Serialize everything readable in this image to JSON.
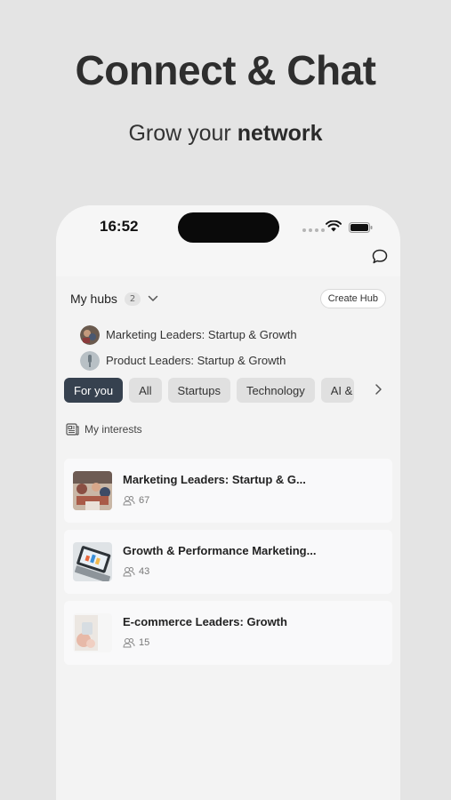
{
  "promo": {
    "headline": "Connect & Chat",
    "subhead_prefix": "Grow your ",
    "subhead_bold": "network"
  },
  "status_bar": {
    "time": "16:52"
  },
  "hubs": {
    "title": "My hubs",
    "count": "2",
    "create_label": "Create Hub",
    "items": [
      {
        "name": "Marketing Leaders: Startup & Growth",
        "avatar_color": "#6a5a4e"
      },
      {
        "name": "Product Leaders: Startup & Growth",
        "avatar_color": "#9aa6ad"
      }
    ]
  },
  "tabs": [
    {
      "label": "For you",
      "active": true
    },
    {
      "label": "All"
    },
    {
      "label": "Startups"
    },
    {
      "label": "Technology"
    },
    {
      "label": "AI & M"
    }
  ],
  "interests": {
    "label": "My interests"
  },
  "groups": [
    {
      "title": "Marketing Leaders: Startup & G...",
      "members": "67"
    },
    {
      "title": "Growth & Performance Marketing...",
      "members": "43"
    },
    {
      "title": "E-commerce Leaders: Growth",
      "members": "15"
    }
  ],
  "colors": {
    "accent_tab": "#36414f",
    "background": "#e4e4e4",
    "phone_bg": "#f3f3f3"
  },
  "icons": {
    "chat": "chat-bubble-icon",
    "chevron": "chevron-down-icon",
    "arrow": "chevron-right-icon",
    "interests": "newspaper-icon",
    "members": "people-icon"
  }
}
